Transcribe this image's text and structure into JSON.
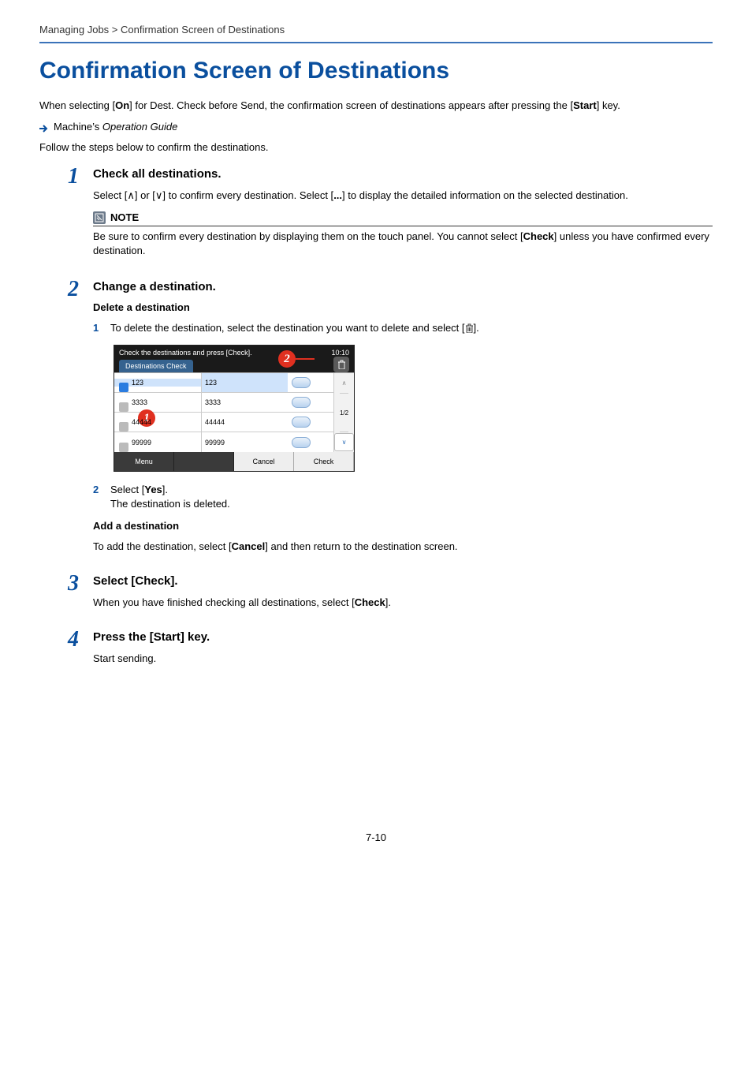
{
  "breadcrumb": "Managing Jobs > Confirmation Screen of Destinations",
  "title": "Confirmation Screen of Destinations",
  "intro": "When selecting [On] for Dest. Check before Send, the confirmation screen of destinations appears after pressing the [Start] key.",
  "xref": "Machine’s Operation Guide",
  "lead": "Follow the steps below to confirm the destinations.",
  "steps": {
    "s1": {
      "num": "1",
      "title": "Check all destinations.",
      "body": "Select [∧] or [∨] to confirm every destination. Select [...] to display the detailed information on the selected destination.",
      "note_label": "NOTE",
      "note_body": "Be sure to confirm every destination by displaying them on the touch panel. You cannot select [Check] unless you have confirmed every destination."
    },
    "s2": {
      "num": "2",
      "title": "Change a destination.",
      "sub_delete_head": "Delete a destination",
      "sub1_num": "1",
      "sub1_text": "To delete the destination, select the destination you want to delete and select [",
      "sub1_text_end": "].",
      "sub2_num": "2",
      "sub2_text": "Select [Yes].",
      "sub2_text2": "The destination is deleted.",
      "sub_add_head": "Add a destination",
      "sub_add_text": "To add the destination, select [Cancel] and then return to the destination screen."
    },
    "s3": {
      "num": "3",
      "title": "Select [Check].",
      "body": "When you have finished checking all destinations, select [Check]."
    },
    "s4": {
      "num": "4",
      "title": "Press the [Start] key.",
      "body": "Start sending."
    }
  },
  "panel": {
    "instruction": "Check the destinations and press [Check].",
    "time": "10:10",
    "tab": "Destinations Check",
    "rows": [
      {
        "name": "123",
        "number": "123"
      },
      {
        "name": "3333",
        "number": "3333"
      },
      {
        "name": "44444",
        "number": "44444"
      },
      {
        "name": "99999",
        "number": "99999"
      }
    ],
    "page": "1/2",
    "menu": "Menu",
    "cancel": "Cancel",
    "check": "Check",
    "callout1": "1",
    "callout2": "2"
  },
  "pagenum": "7-10"
}
